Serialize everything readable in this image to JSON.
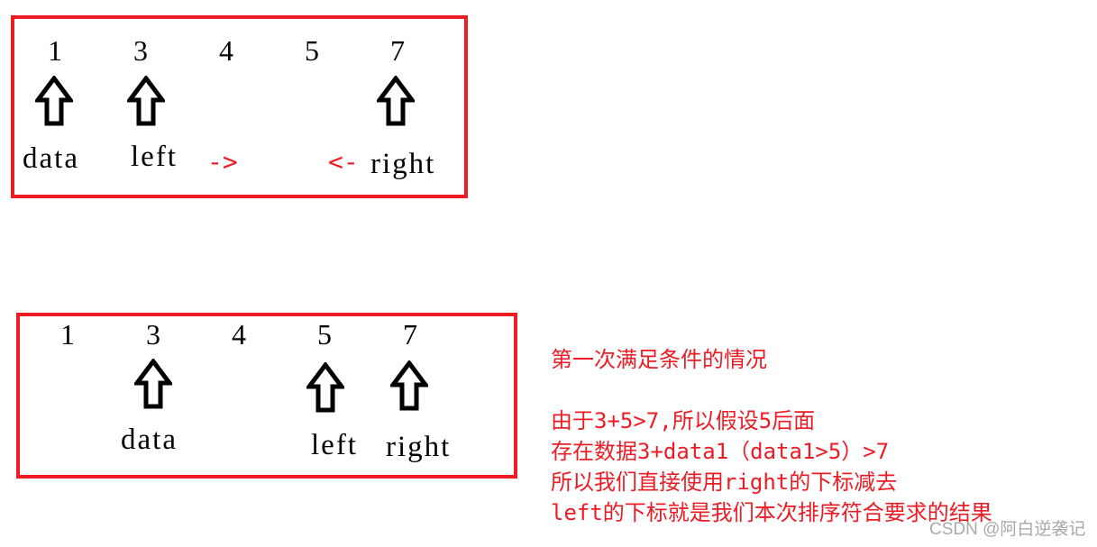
{
  "diagram1": {
    "numbers": [
      "1",
      "3",
      "4",
      "5",
      "7"
    ],
    "labels": {
      "data": "data",
      "left": "left",
      "right": "right"
    },
    "left_direction_arrow": "->",
    "right_direction_arrow": "<-"
  },
  "diagram2": {
    "numbers": [
      "1",
      "3",
      "4",
      "5",
      "7"
    ],
    "labels": {
      "data": "data",
      "left": "left",
      "right": "right"
    }
  },
  "notes": {
    "title": "第一次满足条件的情况",
    "lines": [
      "由于3+5>7,所以假设5后面",
      "存在数据3+data1（data1>5）>7",
      "所以我们直接使用right的下标减去",
      "left的下标就是我们本次排序符合要求的结果"
    ]
  },
  "watermark": "CSDN @阿白逆袭记",
  "colors": {
    "frame": "#ed1c24",
    "annotation": "#ed1c24",
    "watermark": "#a9a9a9"
  }
}
